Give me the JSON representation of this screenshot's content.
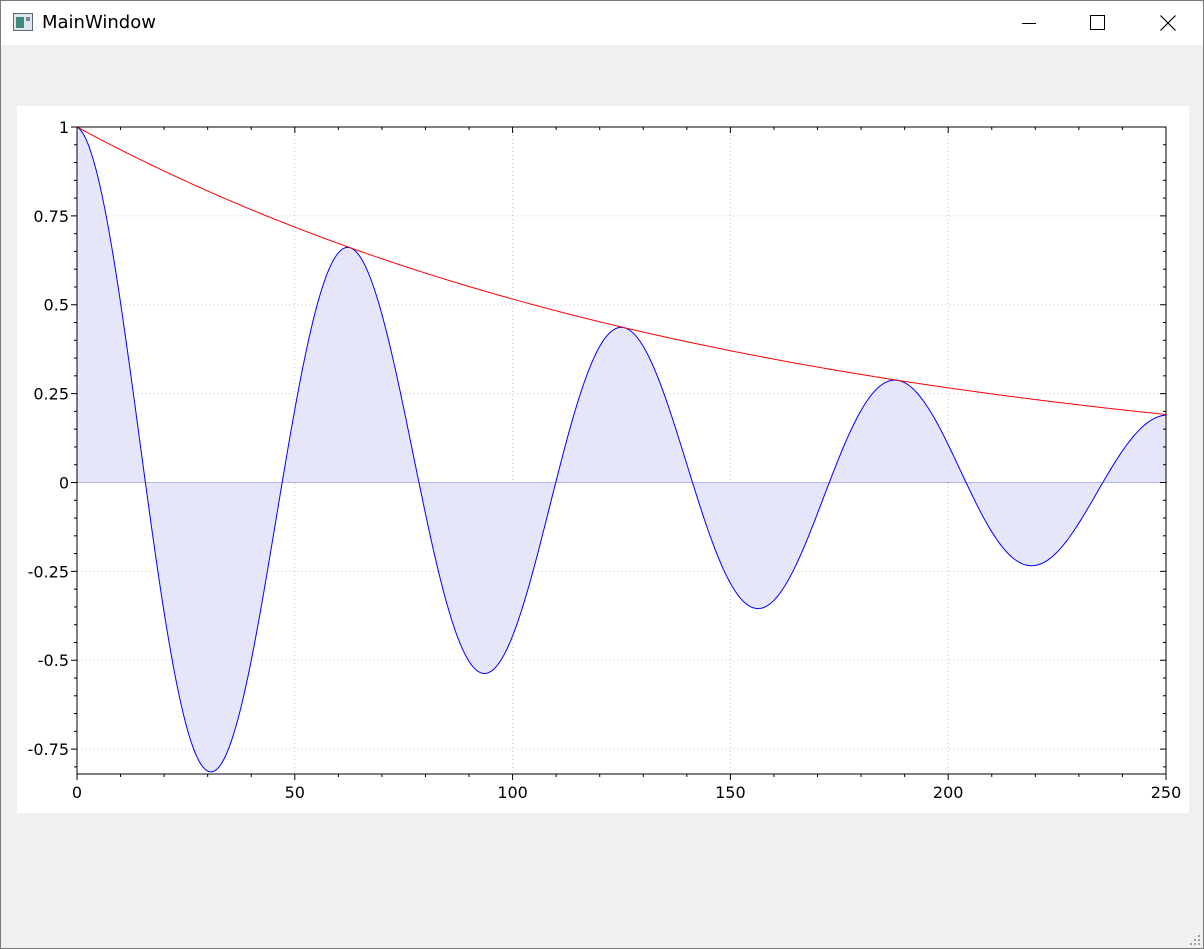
{
  "window": {
    "title": "MainWindow",
    "icon": "app-window-icon",
    "controls": [
      "minimize-icon",
      "maximize-icon",
      "close-icon"
    ]
  },
  "chart_data": {
    "type": "area",
    "title": "",
    "xlabel": "",
    "ylabel": "",
    "xlim": [
      0,
      250
    ],
    "ylim": [
      -0.82,
      1
    ],
    "grid": true,
    "xticks": [
      "0",
      "50",
      "100",
      "150",
      "200",
      "250"
    ],
    "yticks": [
      "1",
      "0.75",
      "0.5",
      "0.25",
      "0",
      "-0.25",
      "-0.5",
      "-0.75"
    ],
    "series": [
      {
        "role": "damped-oscillation",
        "color": "#0000ff",
        "fill": "#e6e6fa",
        "x": [
          0,
          15.7,
          31.4,
          47.1,
          62.8,
          78.5,
          94.2,
          110,
          125.7,
          141.4,
          157.1,
          172.8,
          188.5,
          204.2,
          219.9,
          235.6,
          250
        ],
        "values": [
          1,
          0,
          -0.81,
          0,
          0.66,
          0,
          -0.535,
          0,
          0.43,
          0,
          -0.35,
          0,
          0.285,
          0,
          -0.23,
          0,
          0.19
        ]
      },
      {
        "role": "envelope",
        "color": "#ff0000",
        "x": [
          0,
          25,
          50,
          75,
          100,
          125,
          150,
          175,
          200,
          225,
          250
        ],
        "values": [
          1,
          0.846,
          0.716,
          0.606,
          0.513,
          0.434,
          0.368,
          0.311,
          0.263,
          0.223,
          0.189
        ]
      }
    ]
  }
}
